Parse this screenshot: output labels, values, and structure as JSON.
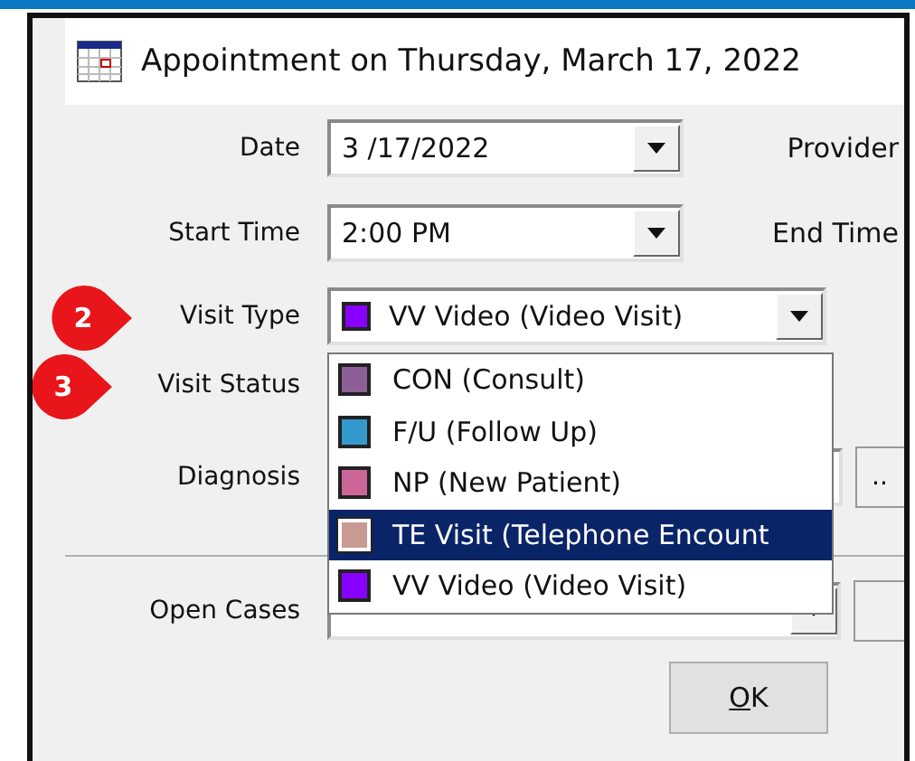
{
  "window": {
    "title": "Appointment on Thursday, March 17, 2022"
  },
  "rows": [
    {
      "kind": "combo",
      "label": "Date",
      "value": "3 /17/2022",
      "side_label": "Provider"
    },
    {
      "kind": "combo",
      "label": "Start Time",
      "value": "2:00 PM",
      "side_label": "End Time"
    },
    {
      "kind": "color_combo",
      "label": "Visit Type",
      "value": "VV Video (Video Visit)",
      "color": "#8800ff",
      "callout": "2"
    },
    {
      "kind": "covered",
      "label": "Visit Status",
      "callout": "3"
    },
    {
      "kind": "field_button",
      "label": "Diagnosis",
      "button": ".."
    },
    {
      "kind": "combo_button",
      "label": "Open Cases"
    }
  ],
  "dropdown": {
    "options": [
      {
        "label": "CON (Consult)",
        "color": "#8e5f96",
        "selected": false
      },
      {
        "label": "F/U (Follow Up)",
        "color": "#3399cc",
        "selected": false
      },
      {
        "label": "NP (New Patient)",
        "color": "#cc6699",
        "selected": false
      },
      {
        "label": "TE Visit (Telephone Encount",
        "color": "#c99a93",
        "selected": true
      },
      {
        "label": "VV Video (Video Visit)",
        "color": "#8800ff",
        "selected": false
      }
    ]
  },
  "buttons": [
    {
      "label": "OK"
    }
  ]
}
